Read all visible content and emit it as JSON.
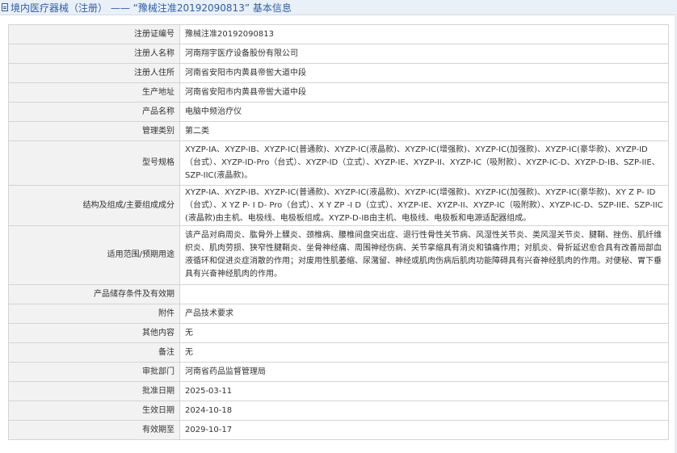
{
  "header": {
    "title": "境内医疗器械（注册） —— “豫械注准20192090813” 基本信息"
  },
  "rows": [
    {
      "label": "注册证编号",
      "value": "豫械注准20192090813"
    },
    {
      "label": "注册人名称",
      "value": "河南翔宇医疗设备股份有限公司"
    },
    {
      "label": "注册人住所",
      "value": "河南省安阳市内黄县帝喾大道中段"
    },
    {
      "label": "生产地址",
      "value": "河南省安阳市内黄县帝喾大道中段"
    },
    {
      "label": "产品名称",
      "value": "电脑中频治疗仪"
    },
    {
      "label": "管理类别",
      "value": "第二类"
    },
    {
      "label": "型号规格",
      "value": "XYZP-IA、XYZP-IB、XYZP-IC(普通款)、XYZP-IC(液晶款)、XYZP-IC(增强款)、XYZP-IC(加强款)、XYZP-IC(豪华款)、XYZP-ID（台式）、XYZP-ID-Pro（台式）、XYZP-ID（立式）、XYZP-IE、XYZP-II、XYZP-IC（吸附款）、XYZP-IC-D、XYZP-D-IB、SZP-IIE、SZP-IIC(液晶款)。"
    },
    {
      "label": "结构及组成/主要组成成分",
      "value": "XYZP-IA、XYZP-IB、XYZP-IC(普通款)、XYZP-IC(液晶款)、XYZP-IC(增强款)、XYZP-IC(加强款)、XYZP-IC(豪华款)、XY Z P- ID（台式）、X YZ P- I D- Pro（台式）、X Y ZP -I D（立式）、XYZP-IE、XYZP-II、XYZP-IC（吸附款）、XYZP-IC-D、SZP-IIE、SZP-IIC(液晶款)由主机、电极线、电极板组成。XYZP-D-IB由主机、电极线、电极板和电源适配器组成。"
    },
    {
      "label": "适用范围/预期用途",
      "value": "该产品对肩周炎、肱骨外上髁炎、颈椎病、腰椎间盘突出症、退行性骨性关节病、风湿性关节炎、类风湿关节炎、腱鞘、挫伤、肌纤维织炎、肌肉劳损、狭窄性腱鞘炎、坐骨神经痛、周围神经伤病、关节挛缩具有消炎和镇痛作用；对肌炎、骨折延迟愈合具有改善局部血液循环和促进炎症消散的作用；对废用性肌萎缩、尿潴留、神经或肌肉伤病后肌肉功能障碍具有兴奋神经肌肉的作用。对便秘、胃下垂具有兴奋神经肌肉的作用。"
    },
    {
      "label": "产品储存条件及有效期",
      "value": ""
    },
    {
      "label": "附件",
      "value": "产品技术要求"
    },
    {
      "label": "其他内容",
      "value": "无"
    },
    {
      "label": "备注",
      "value": "无"
    },
    {
      "label": "审批部门",
      "value": "河南省药品监督管理局"
    },
    {
      "label": "批准日期",
      "value": "2025-03-11"
    },
    {
      "label": "生效日期",
      "value": "2024-10-18"
    },
    {
      "label": "有效期至",
      "value": "2029-10-17"
    }
  ]
}
